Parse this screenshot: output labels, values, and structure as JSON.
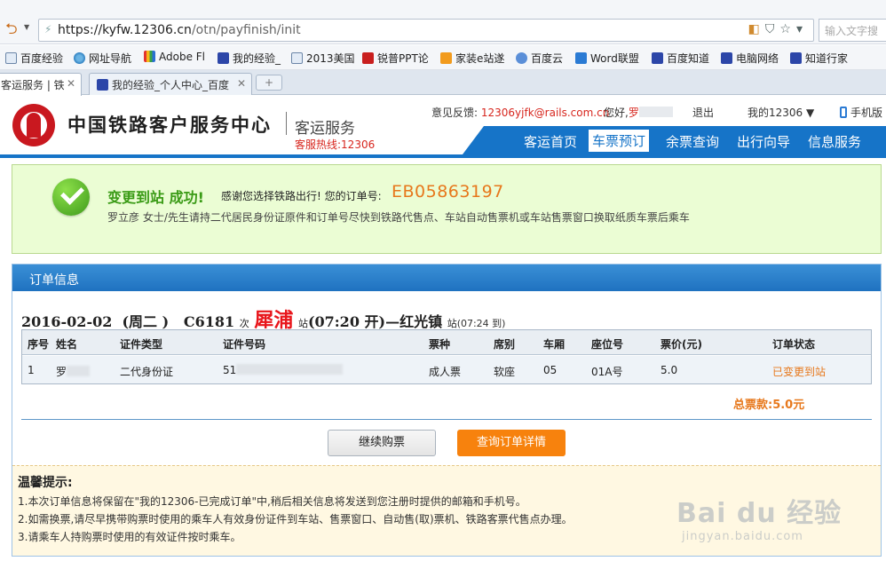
{
  "browser": {
    "url_main": "https://kyfw.12306.cn",
    "url_path": "/otn/payfinish/init",
    "search_placeholder": "输入文字搜",
    "bookmarks": [
      "百度经验",
      "网址导航",
      "Adobe Fl",
      "我的经验_",
      "2013美国",
      "锐普PPT论",
      "家装e站遂",
      "百度云",
      "Word联盟",
      "百度知道",
      "电脑网络",
      "知道行家"
    ],
    "tabs": [
      {
        "label": "客运服务 | 铁",
        "close": "✕"
      },
      {
        "label": "我的经验_个人中心_百度",
        "close": "✕"
      }
    ],
    "newtab": "+"
  },
  "header": {
    "title": "中国铁路客户服务中心",
    "subtitle": "客运服务",
    "hotline": "客服热线:12306",
    "feedback_label": "意见反馈:",
    "feedback_email": "12306yjfk@rails.com.cn",
    "greeting": "您好,",
    "user_name": "罗",
    "logout": "退出",
    "my12306": "我的12306",
    "mobile": "手机版",
    "nav": [
      "客运首页",
      "车票预订",
      "余票查询",
      "出行向导",
      "信息服务"
    ]
  },
  "success": {
    "title": "变更到站 成功!",
    "thanks": "感谢您选择铁路出行! 您的订单号:",
    "order_no": "EB05863197",
    "note": "罗立彦 女士/先生请持二代居民身份证原件和订单号尽快到铁路代售点、车站自动售票机或车站售票窗口换取纸质车票后乘车"
  },
  "order": {
    "panel_title": "订单信息",
    "date": "2016-02-02",
    "weekday": "(周二 )",
    "train": "C6181",
    "ci": "次",
    "from": "犀浦",
    "zhan": "站",
    "depart": "(07:20 开)",
    "dash_to": "—红光镇",
    "zhan2": "站",
    "arrive": "(07:24 到)",
    "columns": [
      "序号",
      "姓名",
      "证件类型",
      "证件号码",
      "票种",
      "席别",
      "车厢",
      "座位号",
      "票价(元)",
      "订单状态"
    ],
    "row": {
      "no": "1",
      "name": "罗",
      "id_type": "二代身份证",
      "id_no": "51",
      "ticket_type": "成人票",
      "seat_class": "软座",
      "car": "05",
      "seat": "01A号",
      "price": "5.0",
      "status": "已变更到站"
    },
    "total": "总票款:5.0元",
    "btn_continue": "继续购票",
    "btn_detail": "查询订单详情"
  },
  "tips": {
    "title": "温馨提示:",
    "items": [
      "1.本次订单信息将保留在\"我的12306-已完成订单\"中,稍后相关信息将发送到您注册时提供的邮箱和手机号。",
      "2.如需换票,请尽早携带购票时使用的乘车人有效身份证件到车站、售票窗口、自动售(取)票机、铁路客票代售点办理。",
      "3.请乘车人持购票时使用的有效证件按时乘车。"
    ]
  },
  "watermark": {
    "main": "Bai du 经验",
    "sub": "jingyan.baidu.com"
  }
}
